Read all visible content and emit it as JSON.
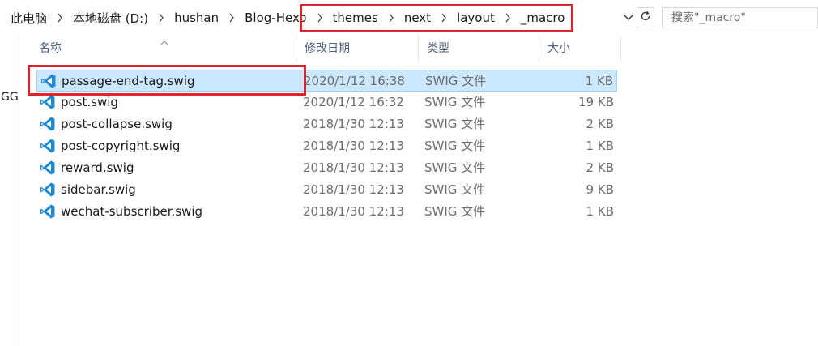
{
  "breadcrumb": {
    "items": [
      "此电脑",
      "本地磁盘 (D:)",
      "hushan",
      "Blog-Hexo",
      "themes",
      "next",
      "layout",
      "_macro"
    ]
  },
  "search": {
    "placeholder": "搜索\"_macro\""
  },
  "nav": {
    "partial_label": "GG"
  },
  "columns": {
    "name": "名称",
    "date": "修改日期",
    "type": "类型",
    "size": "大小"
  },
  "files": [
    {
      "name": "passage-end-tag.swig",
      "date": "2020/1/12 16:38",
      "type": "SWIG 文件",
      "size": "1 KB",
      "selected": true
    },
    {
      "name": "post.swig",
      "date": "2020/1/12 16:32",
      "type": "SWIG 文件",
      "size": "19 KB",
      "selected": false
    },
    {
      "name": "post-collapse.swig",
      "date": "2018/1/30 12:13",
      "type": "SWIG 文件",
      "size": "2 KB",
      "selected": false
    },
    {
      "name": "post-copyright.swig",
      "date": "2018/1/30 12:13",
      "type": "SWIG 文件",
      "size": "1 KB",
      "selected": false
    },
    {
      "name": "reward.swig",
      "date": "2018/1/30 12:13",
      "type": "SWIG 文件",
      "size": "2 KB",
      "selected": false
    },
    {
      "name": "sidebar.swig",
      "date": "2018/1/30 12:13",
      "type": "SWIG 文件",
      "size": "9 KB",
      "selected": false
    },
    {
      "name": "wechat-subscriber.swig",
      "date": "2018/1/30 12:13",
      "type": "SWIG 文件",
      "size": "1 KB",
      "selected": false
    }
  ],
  "icons": {
    "file": "vscode-file-icon",
    "refresh": "refresh-icon",
    "dropdown": "chevron-down-icon",
    "separator": "chevron-right-icon"
  },
  "colors": {
    "selection": "#cce8ff",
    "annotation": "#e0242b",
    "vscode_blue": "#1f8ad2"
  }
}
